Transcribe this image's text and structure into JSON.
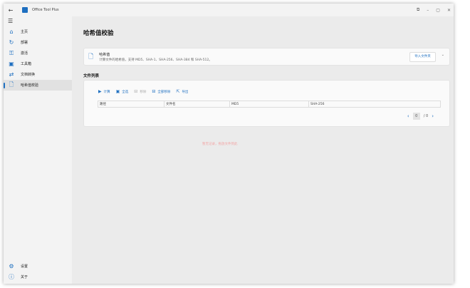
{
  "window": {
    "title": "Office Tool Plus",
    "controls": [
      "⧉",
      "–",
      "▢",
      "✕"
    ]
  },
  "sidebar": {
    "items": [
      {
        "label": "主页",
        "icon": "⌂"
      },
      {
        "label": "部署",
        "icon": "↻"
      },
      {
        "label": "激活",
        "icon": "⚿"
      },
      {
        "label": "工具箱",
        "icon": "▣"
      },
      {
        "label": "文档转换",
        "icon": "⇄"
      },
      {
        "label": "哈希值校验",
        "icon": "🗋"
      }
    ],
    "bottom": [
      {
        "label": "设置",
        "icon": "⚙"
      },
      {
        "label": "关于",
        "icon": "ⓘ"
      }
    ]
  },
  "main": {
    "title": "哈希值校验",
    "info": {
      "title": "哈希值",
      "desc": "计算文件的哈希值，支持 MD5、SHA-1、SHA-256、SHA-384 和 SHA-512。",
      "import": "导入文件夹"
    },
    "section": "文件列表",
    "toolbar": {
      "calc": "计算",
      "select_all": "全选",
      "remove": "移除",
      "remove_all": "全部移除",
      "export": "导出"
    },
    "columns": [
      "路径",
      "文件名",
      "MD5",
      "SHA-256"
    ],
    "pager": {
      "page": "0",
      "total": "/ 0"
    },
    "hint": "暂无记录，拖放文件到此"
  }
}
